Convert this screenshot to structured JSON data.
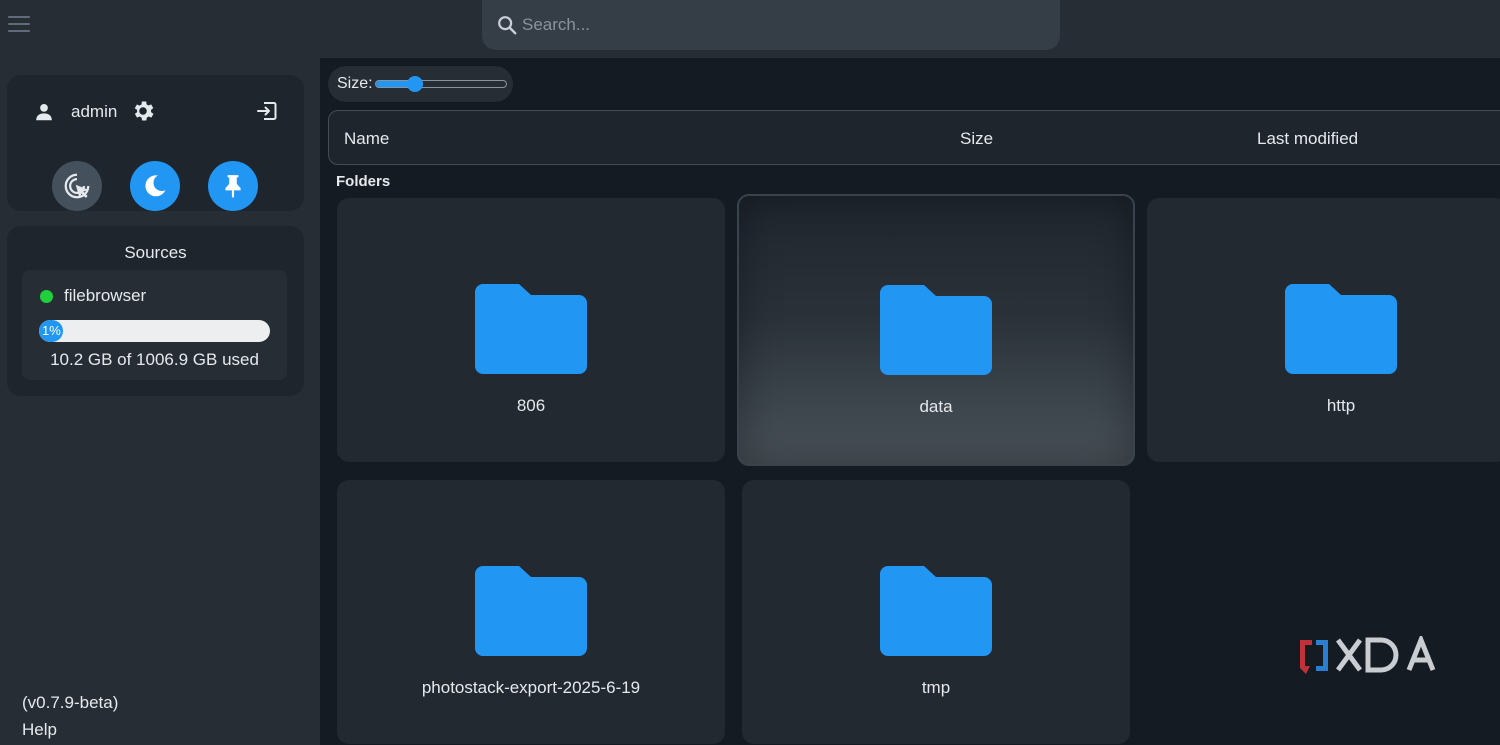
{
  "search": {
    "placeholder": "Search..."
  },
  "user": {
    "name": "admin"
  },
  "sources": {
    "title": "Sources",
    "items": [
      {
        "name": "filebrowser",
        "status_color": "#1fcf3c",
        "usage_percent": 1,
        "usage_label": "1%",
        "usage_text": "10.2 GB of 1006.9 GB used"
      }
    ]
  },
  "footer": {
    "version": "(v0.7.9-beta)",
    "help": "Help"
  },
  "size_control": {
    "label": "Size:",
    "value_fraction": 0.3
  },
  "columns": {
    "name": "Name",
    "size": "Size",
    "modified": "Last modified"
  },
  "section": {
    "folders": "Folders"
  },
  "folders": [
    {
      "name": "806"
    },
    {
      "name": "data"
    },
    {
      "name": "http"
    },
    {
      "name": "photostack-export-2025-6-19"
    },
    {
      "name": "tmp"
    }
  ],
  "colors": {
    "accent": "#2196f3",
    "sidebar": "#262d35",
    "background": "#151b22"
  }
}
